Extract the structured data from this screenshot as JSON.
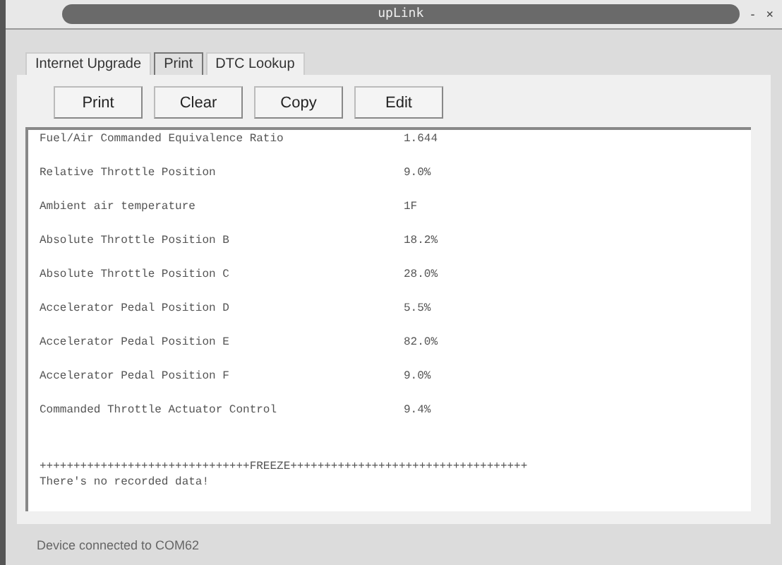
{
  "window": {
    "title": "upLink",
    "controls": [
      "-",
      "×"
    ]
  },
  "tabs": [
    {
      "label": "Internet Upgrade",
      "selected": false
    },
    {
      "label": "Print",
      "selected": true
    },
    {
      "label": "DTC Lookup",
      "selected": false
    }
  ],
  "buttons": [
    "Print",
    "Clear",
    "Copy",
    "Edit"
  ],
  "readings": [
    {
      "name": "Fuel/Air Commanded Equivalence Ratio",
      "value": "1.644"
    },
    {
      "name": "Relative Throttle Position",
      "value": "9.0%"
    },
    {
      "name": "Ambient air temperature",
      "value": "1F"
    },
    {
      "name": "Absolute Throttle Position B",
      "value": "18.2%"
    },
    {
      "name": "Absolute Throttle Position C",
      "value": "28.0%"
    },
    {
      "name": "Accelerator Pedal Position D",
      "value": "5.5%"
    },
    {
      "name": "Accelerator Pedal Position E",
      "value": "82.0%"
    },
    {
      "name": "Accelerator Pedal Position F",
      "value": "9.0%"
    },
    {
      "name": "Commanded Throttle Actuator Control",
      "value": "9.4%"
    }
  ],
  "separator": "+++++++++++++++++++++++++++++++FREEZE+++++++++++++++++++++++++++++++++++",
  "message": "There's no recorded data!",
  "status_bar": "Device connected to COM62"
}
